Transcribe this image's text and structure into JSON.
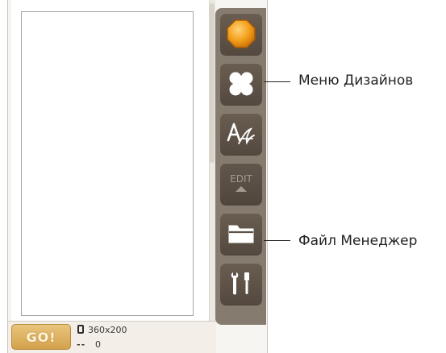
{
  "status_bar": {
    "go_label": "GO!",
    "hoop_size": "360x200",
    "stitch_symbol": "--",
    "stitch_count": "0"
  },
  "toolbar": {
    "items": [
      {
        "name": "start",
        "icon": "orange-octagon-icon"
      },
      {
        "name": "design-menu",
        "icon": "four-leaf-icon"
      },
      {
        "name": "text-edit",
        "icon": "font-a-icon"
      },
      {
        "name": "edit",
        "icon": "edit-arrow-icon",
        "label": "EDIT",
        "state": "disabled"
      },
      {
        "name": "file-manager",
        "icon": "folder-icon"
      },
      {
        "name": "settings",
        "icon": "tools-icon"
      }
    ]
  },
  "callouts": {
    "design_menu": "Меню Дизайнов",
    "file_manager": "Файл Менеджер"
  },
  "colors": {
    "toolbar_bg": "#857b6f",
    "button_bg": "#5e5247",
    "accent_orange": "#f29b1d",
    "go_button": "#dcaa54"
  }
}
